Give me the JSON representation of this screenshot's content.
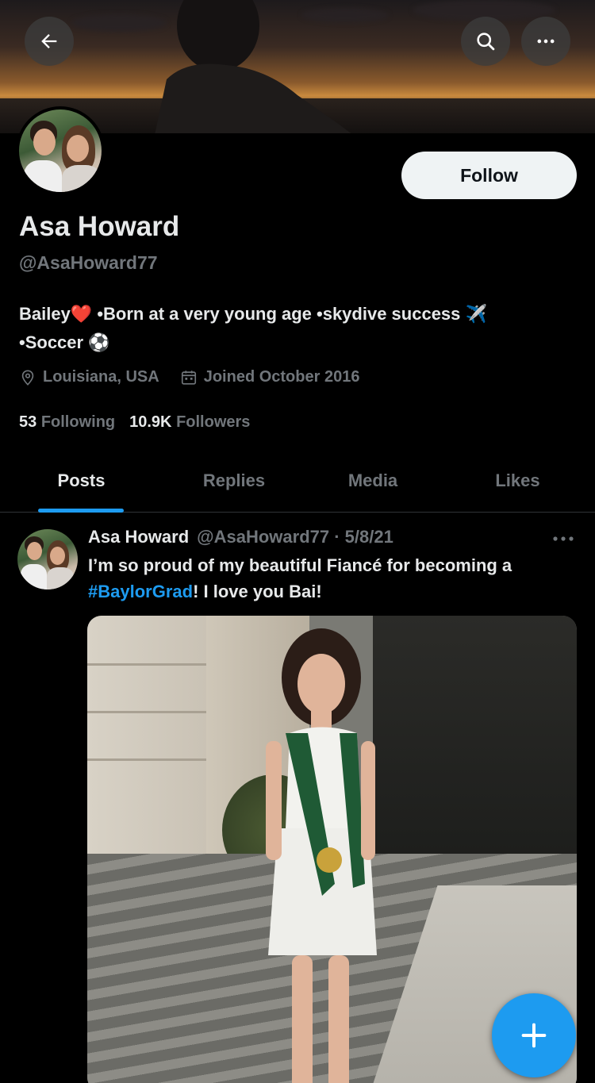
{
  "profile": {
    "name": "Asa Howard",
    "handle": "@AsaHoward77",
    "follow_label": "Follow",
    "bio_part1": "Bailey",
    "bio_heart": "❤️",
    "bio_part2": " •Born at a very young age •skydive success ",
    "bio_plane": "✈️",
    "bio_part3": "•Soccer ",
    "bio_ball": "⚽",
    "location": "Louisiana, USA",
    "joined": "Joined October 2016",
    "following_count": "53",
    "following_label": "Following",
    "followers_count": "10.9K",
    "followers_label": "Followers"
  },
  "tabs": [
    {
      "label": "Posts",
      "active": true
    },
    {
      "label": "Replies",
      "active": false
    },
    {
      "label": "Media",
      "active": false
    },
    {
      "label": "Likes",
      "active": false
    }
  ],
  "post": {
    "author_name": "Asa Howard",
    "author_handle": "@AsaHoward77 · 5/8/21",
    "text_before": "I’m so proud of my beautiful Fiancé for becoming a ",
    "hashtag": "#BaylorGrad",
    "text_after": "! I love you Bai!"
  },
  "icons": {
    "back": "arrow-left-icon",
    "search": "search-icon",
    "more": "more-horizontal-icon",
    "location": "location-pin-icon",
    "calendar": "calendar-icon",
    "compose": "plus-icon"
  },
  "colors": {
    "accent": "#1d9bf0",
    "background": "#000000",
    "text_primary": "#e7e9ea",
    "text_secondary": "#71767b"
  }
}
